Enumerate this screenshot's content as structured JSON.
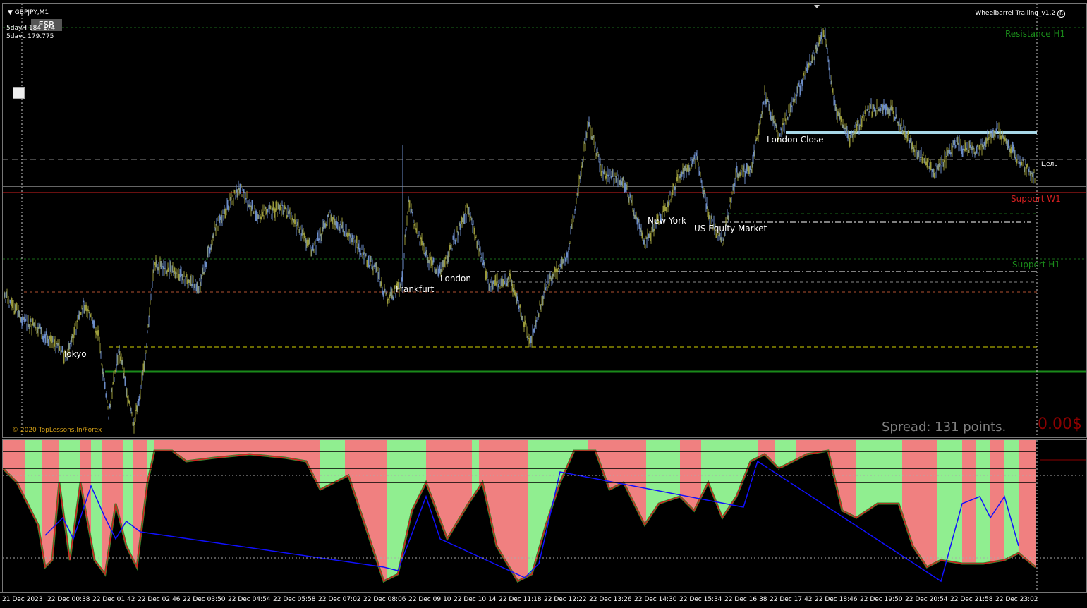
{
  "window": {
    "symbol": "GBPJPY,M1",
    "indicator_name": "Wheelbarrel Trailing_v1.2"
  },
  "header": {
    "fsr_button": "FSR",
    "five_day_high": "5dayH 184.174",
    "five_day_low": "5dayL 179.775"
  },
  "levels": {
    "resistance_h1": "Resistance H1",
    "support_w1": "Support W1",
    "support_h1": "Support H1",
    "target": "Цель"
  },
  "sessions": {
    "tokyo": "Tokyo",
    "frankfurt": "Frankfurt",
    "london": "London",
    "new_york": "New York",
    "us_equity": "US Equity Market",
    "london_close": "London Close"
  },
  "status": {
    "spread": "Spread: 131 points.",
    "profit": "0.00$",
    "copyright": "© 2020 TopLessons.In/Forex"
  },
  "time_axis": [
    "21 Dec 2023",
    "22 Dec 00:38",
    "22 Dec 01:42",
    "22 Dec 02:46",
    "22 Dec 03:50",
    "22 Dec 04:54",
    "22 Dec 05:58",
    "22 Dec 07:02",
    "22 Dec 08:06",
    "22 Dec 09:10",
    "22 Dec 10:14",
    "22 Dec 11:18",
    "22 Dec 12:22",
    "22 Dec 13:26",
    "22 Dec 14:30",
    "22 Dec 15:34",
    "22 Dec 16:38",
    "22 Dec 17:42",
    "22 Dec 18:46",
    "22 Dec 19:50",
    "22 Dec 20:54",
    "22 Dec 21:58",
    "22 Dec 23:02"
  ],
  "colors": {
    "bull_bar": "#6b8cc7",
    "bear_bar": "#9a9a3a",
    "support_w1": "#d22020",
    "resistance_green": "#1a8a1a",
    "osc_up": "#90ee90",
    "osc_down": "#f08080"
  }
}
